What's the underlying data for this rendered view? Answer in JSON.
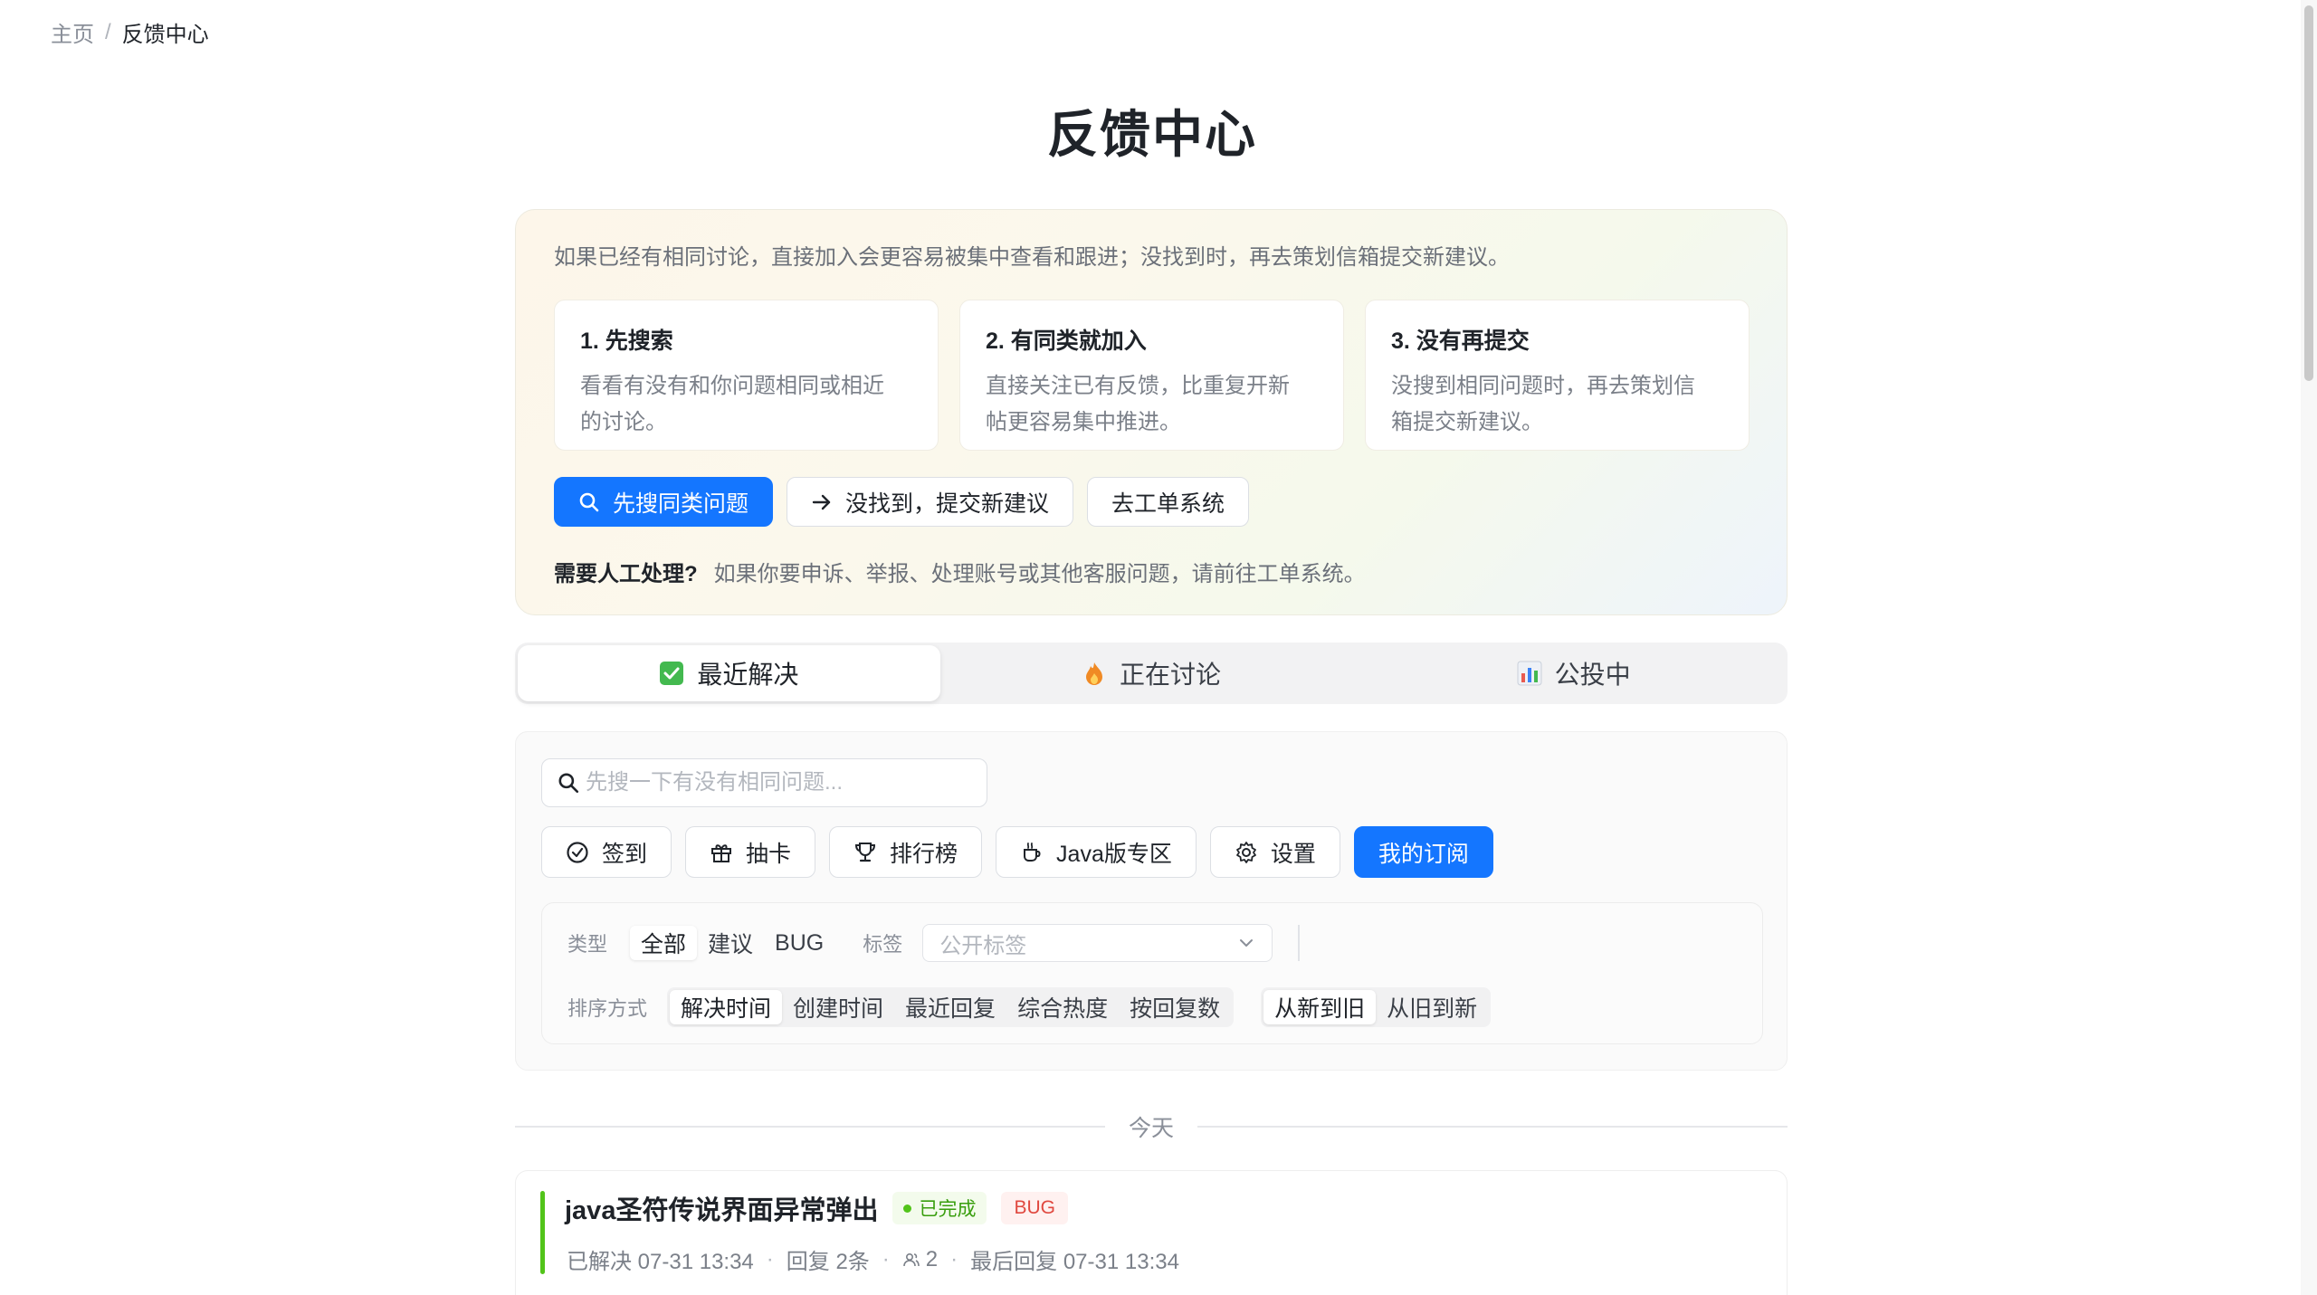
{
  "breadcrumb": {
    "home": "主页",
    "separator": "/",
    "current": "反馈中心"
  },
  "page": {
    "title": "反馈中心"
  },
  "guide": {
    "intro": "如果已经有相同讨论，直接加入会更容易被集中查看和跟进；没找到时，再去策划信箱提交新建议。",
    "steps": [
      {
        "title": "1. 先搜索",
        "desc_line1": "看看有没有和你问题相同或相近",
        "desc_line2": "的讨论。"
      },
      {
        "title": "2. 有同类就加入",
        "desc_line1": "直接关注已有反馈，比重复开新",
        "desc_line2": "帖更容易集中推进。"
      },
      {
        "title": "3. 没有再提交",
        "desc_line1": "没搜到相同问题时，再去策划信",
        "desc_line2": "箱提交新建议。"
      }
    ],
    "actions": {
      "search_similar": "先搜同类问题",
      "submit_new": "没找到，提交新建议",
      "ticket_system": "去工单系统"
    },
    "human_title": "需要人工处理?",
    "human_text": "如果你要申诉、举报、处理账号或其他客服问题，请前往工单系统。"
  },
  "tabs": [
    {
      "label": "最近解决",
      "icon": "check-box-icon",
      "active": true
    },
    {
      "label": "正在讨论",
      "icon": "fire-icon",
      "active": false
    },
    {
      "label": "公投中",
      "icon": "bar-chart-icon",
      "active": false
    }
  ],
  "search": {
    "placeholder": "先搜一下有没有相同问题...",
    "value": ""
  },
  "toolbar": {
    "checkin": "签到",
    "draw_card": "抽卡",
    "leaderboard": "排行榜",
    "java_zone": "Java版专区",
    "settings": "设置",
    "my_subscriptions": "我的订阅"
  },
  "filters": {
    "type_label": "类型",
    "types": [
      "全部",
      "建议",
      "BUG"
    ],
    "type_selected": "全部",
    "tag_label": "标签",
    "tag_placeholder": "公开标签",
    "sort_label": "排序方式",
    "sorts": [
      "解决时间",
      "创建时间",
      "最近回复",
      "综合热度",
      "按回复数"
    ],
    "sort_selected": "解决时间",
    "orders": [
      "从新到旧",
      "从旧到新"
    ],
    "order_selected": "从新到旧"
  },
  "feed": {
    "group_label": "今天",
    "items": [
      {
        "title": "java圣符传说界面异常弹出",
        "status": "已完成",
        "tag": "BUG",
        "resolved": "已解决 07-31 13:34",
        "replies": "回复 2条",
        "followers": "2",
        "last_reply": "最后回复 07-31 13:34"
      }
    ]
  },
  "colors": {
    "primary": "#1476ff",
    "success": "#52c41a",
    "danger": "#e0483f"
  }
}
